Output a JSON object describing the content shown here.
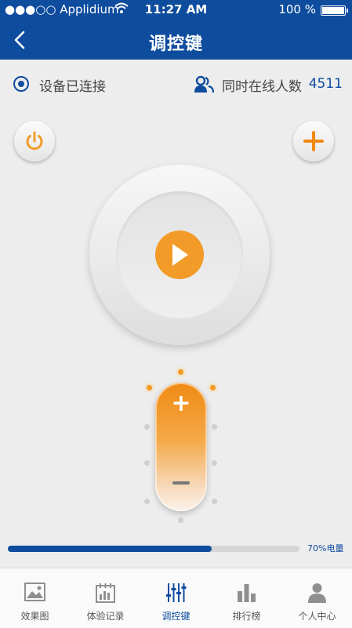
{
  "status_bar": {
    "carrier": "●●●○○ Applidium",
    "time": "11:27 AM",
    "battery": "100 %"
  },
  "nav": {
    "title": "调控键"
  },
  "connection": {
    "label": "设备已连接"
  },
  "online": {
    "label": "同时在线人数",
    "count": "4511"
  },
  "battery_charge": {
    "percent": 70,
    "label": "70%电量"
  },
  "tabs": [
    {
      "label": "效果图",
      "icon": "image-icon"
    },
    {
      "label": "体验记录",
      "icon": "calendar-icon"
    },
    {
      "label": "调控键",
      "icon": "equalizer-icon",
      "active": true
    },
    {
      "label": "排行榜",
      "icon": "bar-chart-icon"
    },
    {
      "label": "个人中心",
      "icon": "person-icon"
    }
  ],
  "colors": {
    "brand_blue": "#0e4c9e",
    "accent_orange": "#f29b28"
  }
}
